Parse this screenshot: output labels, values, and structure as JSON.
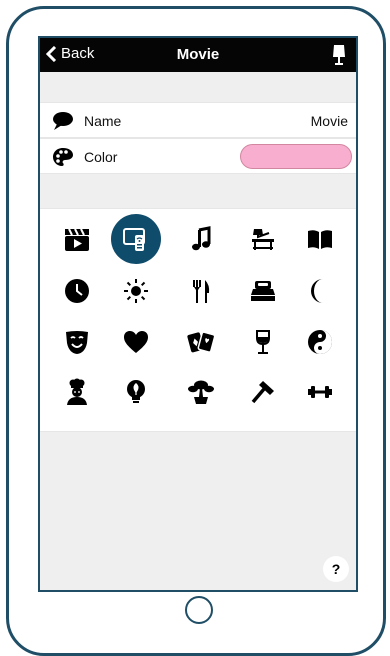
{
  "nav": {
    "back_label": "Back",
    "title": "Movie",
    "right_icon": "lamp-icon"
  },
  "settings": {
    "name": {
      "label": "Name",
      "value": "Movie",
      "icon": "speech-bubble-icon"
    },
    "color": {
      "label": "Color",
      "icon": "palette-icon",
      "value_hex": "#f8afcf"
    }
  },
  "icons": [
    [
      "movie-clapper-icon",
      "tv-remote-icon",
      "music-note-icon",
      "desk-lamp-icon",
      "book-icon"
    ],
    [
      "clock-icon",
      "sun-icon",
      "fork-knife-icon",
      "bed-icon",
      "moon-icon"
    ],
    [
      "theater-mask-icon",
      "heart-icon",
      "playing-cards-icon",
      "wine-glass-icon",
      "yin-yang-icon"
    ],
    [
      "chef-icon",
      "bulb-leaf-icon",
      "bonsai-tree-icon",
      "hammer-icon",
      "dumbbell-icon"
    ]
  ],
  "selected_icon": "tv-remote-icon",
  "help_label": "?",
  "colors": {
    "frame": "#1f4e66",
    "navbar": "#050505",
    "selected": "#0f4c6c",
    "swatch": "#f8afcf"
  }
}
